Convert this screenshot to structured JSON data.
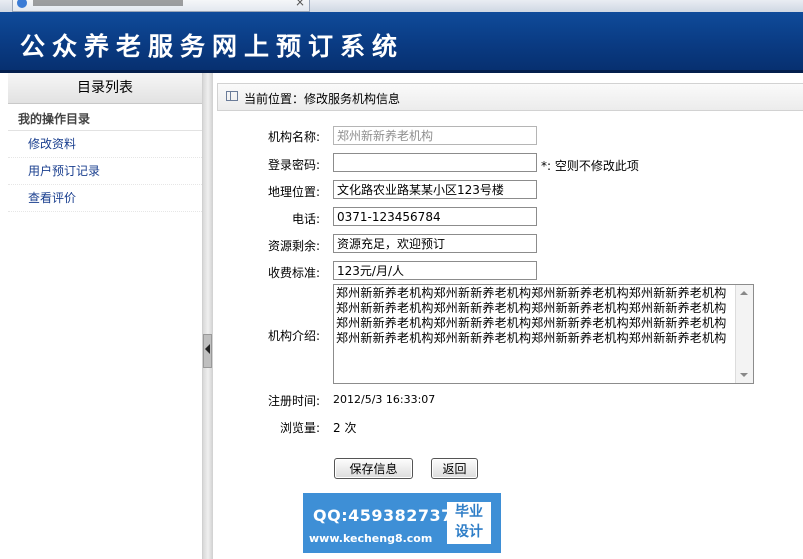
{
  "banner": {
    "title": "公众养老服务网上预订系统"
  },
  "sidebar": {
    "heading": "目录列表",
    "group": "我的操作目录",
    "items": [
      {
        "label": "修改资料"
      },
      {
        "label": "用户预订记录"
      },
      {
        "label": "查看评价"
      }
    ]
  },
  "breadcrumb": {
    "text": "当前位置：修改服务机构信息"
  },
  "form": {
    "name": {
      "label": "机构名称:",
      "value": "郑州新新养老机构"
    },
    "password": {
      "label": "登录密码:",
      "value": "",
      "note": "*: 空则不修改此项"
    },
    "address": {
      "label": "地理位置:",
      "value": "文化路农业路某某小区123号楼"
    },
    "phone": {
      "label": "电话:",
      "value": "0371-123456784"
    },
    "resource": {
      "label": "资源剩余:",
      "value": "资源充足，欢迎预订"
    },
    "fee": {
      "label": "收费标准:",
      "value": "123元/月/人"
    },
    "intro": {
      "label": "机构介绍:",
      "value": "郑州新新养老机构郑州新新养老机构郑州新新养老机构郑州新新养老机构郑州新新养老机构郑州新新养老机构郑州新新养老机构郑州新新养老机构郑州新新养老机构郑州新新养老机构郑州新新养老机构郑州新新养老机构郑州新新养老机构郑州新新养老机构郑州新新养老机构郑州新新养老机构"
    },
    "registered": {
      "label": "注册时间:",
      "value": "2012/5/3 16:33:07"
    },
    "views": {
      "label": "浏览量:",
      "value": "2 次"
    }
  },
  "buttons": {
    "save": "保存信息",
    "back": "返回"
  },
  "watermark": {
    "qq": "QQ:459382737",
    "site": "www.kecheng8.com",
    "tag_line1": "毕业",
    "tag_line2": "设计"
  },
  "colors": {
    "banner": "#0a3b83",
    "link": "#1a3f8f",
    "watermark": "#3e8fd6"
  }
}
